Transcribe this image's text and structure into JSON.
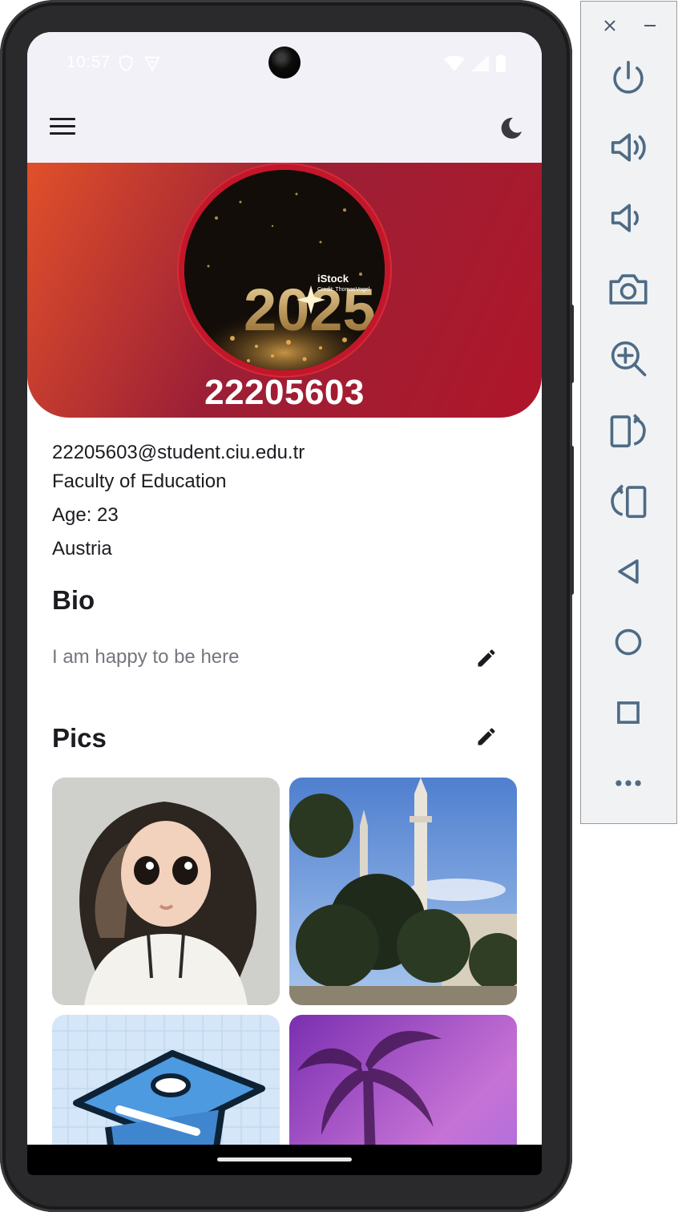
{
  "status_bar": {
    "time": "10:57"
  },
  "profile": {
    "username": "22205603",
    "email": "22205603@student.ciu.edu.tr",
    "faculty": "Faculty of Education",
    "age": "Age: 23",
    "country": "Austria",
    "avatar_watermark": "iStock",
    "avatar_credit": "Credit: ThomasVogel",
    "avatar_year_text": "2025"
  },
  "bio": {
    "title": "Bio",
    "text": "I am happy to be here"
  },
  "pics": {
    "title": "Pics",
    "items": [
      {
        "icon": "cartoon-girl-image"
      },
      {
        "icon": "minaret-mosque-image"
      },
      {
        "icon": "graduation-cap-image"
      },
      {
        "icon": "palm-tree-purple-image"
      }
    ]
  },
  "colors": {
    "banner_start": "#e0502a",
    "banner_end": "#b0152a",
    "app_bar_bg": "#f2f1f7",
    "text_primary": "#1d1b20",
    "text_secondary": "#79747e"
  },
  "emulator_toolbar": {
    "items": [
      "power-icon",
      "volume-up-icon",
      "volume-down-icon",
      "camera-icon",
      "zoom-in-icon",
      "rotate-left-icon",
      "rotate-right-icon",
      "back-icon",
      "home-icon",
      "overview-icon",
      "more-icon"
    ]
  }
}
